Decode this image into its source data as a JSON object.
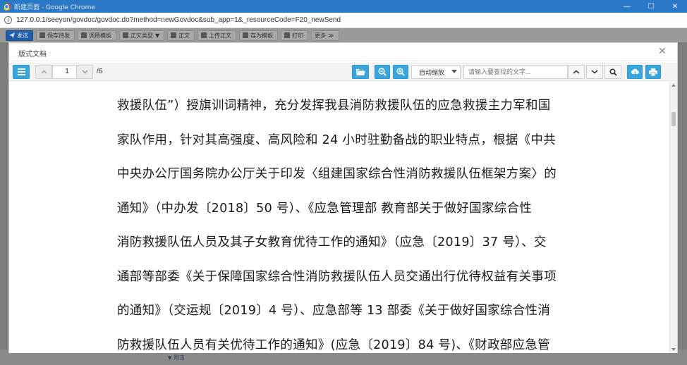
{
  "window": {
    "title": "新建页面 - Google Chrome",
    "minimize_glyph": "—",
    "maximize_glyph": "☐",
    "close_glyph": "✕"
  },
  "address": {
    "url": "127.0.0.1/seeyon/govdoc/govdoc.do?method=newGovdoc&sub_app=1&_resourceCode=F20_newSend"
  },
  "app_toolbar": {
    "send": "发送",
    "save_draft": "保存待发",
    "template": "调用模板",
    "doc_type": "正文类型",
    "doc_type_caret": "▼",
    "body": "正文",
    "upload_body": "上传正文",
    "save_as_template": "存为模板",
    "print": "打印",
    "more": "更多",
    "more_caret": "≫"
  },
  "attachment": {
    "label": "附言",
    "chevron": "▼"
  },
  "modal": {
    "title": "版式文档",
    "close_glyph": "✕"
  },
  "viewer": {
    "current_page": "1",
    "page_total": "/6",
    "zoom_value": "自动缩放",
    "search_placeholder": "请输入要查找的文字..."
  },
  "document": {
    "lines": [
      "救援队伍”）授旗训词精神，充分发挥我县消防救援队伍的应急救援主力军和国",
      "家队作用，针对其高强度、高风险和 24 小时驻勤备战的职业特点，根据《中共",
      "中央办公厅国务院办公厅关于印发〈组建国家综合性消防救援队伍框架方案〉的",
      "通知》（中办发〔2018〕50 号）、《应急管理部  教育部关于做好国家综合性",
      "消防救援队伍人员及其子女教育优待工作的通知》（应急〔2019〕37 号）、交",
      "通部等部委《关于保障国家综合性消防救援队伍人员交通出行优待权益有关事项",
      "的通知》（交运规〔2019〕4 号）、应急部等 13 部委《关于做好国家综合性消",
      "防救援队伍人员有关优待工作的通知》(应急〔2019〕84 号)、《财政部应急管"
    ]
  },
  "colors": {
    "chrome_titlebar": "#2b79c6",
    "viewer_button_blue": "#3aa6e0",
    "send_button": "#1d5ea8"
  },
  "icons": {
    "sidebar_toggle": "list-icon",
    "prev_page": "chevron-up-icon",
    "next_page": "chevron-down-icon",
    "open_file": "folder-icon",
    "zoom_out": "zoom-out-icon",
    "zoom_in": "zoom-in-icon",
    "find_prev": "chevron-up-icon",
    "find_next": "chevron-down-icon",
    "find": "search-icon",
    "download": "cloud-download-icon",
    "print": "printer-icon"
  }
}
